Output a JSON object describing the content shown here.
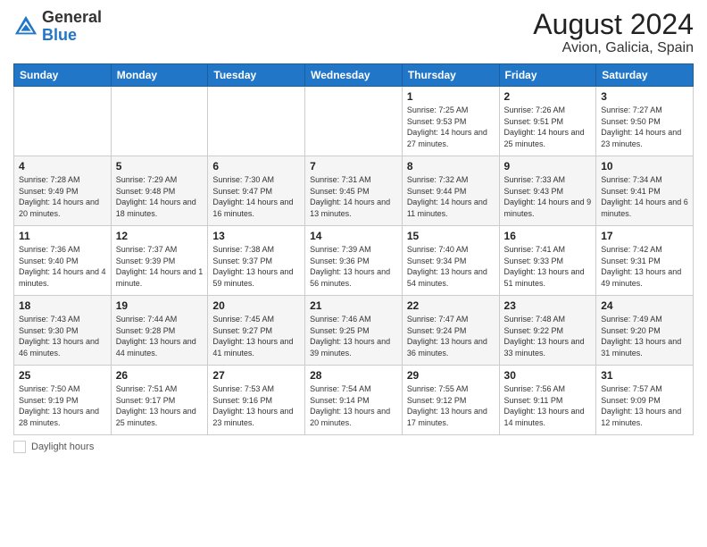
{
  "header": {
    "logo_general": "General",
    "logo_blue": "Blue",
    "month_year": "August 2024",
    "location": "Avion, Galicia, Spain"
  },
  "weekdays": [
    "Sunday",
    "Monday",
    "Tuesday",
    "Wednesday",
    "Thursday",
    "Friday",
    "Saturday"
  ],
  "footer": {
    "daylight_label": "Daylight hours"
  },
  "weeks": [
    [
      {
        "day": "",
        "info": ""
      },
      {
        "day": "",
        "info": ""
      },
      {
        "day": "",
        "info": ""
      },
      {
        "day": "",
        "info": ""
      },
      {
        "day": "1",
        "info": "Sunrise: 7:25 AM\nSunset: 9:53 PM\nDaylight: 14 hours and 27 minutes."
      },
      {
        "day": "2",
        "info": "Sunrise: 7:26 AM\nSunset: 9:51 PM\nDaylight: 14 hours and 25 minutes."
      },
      {
        "day": "3",
        "info": "Sunrise: 7:27 AM\nSunset: 9:50 PM\nDaylight: 14 hours and 23 minutes."
      }
    ],
    [
      {
        "day": "4",
        "info": "Sunrise: 7:28 AM\nSunset: 9:49 PM\nDaylight: 14 hours and 20 minutes."
      },
      {
        "day": "5",
        "info": "Sunrise: 7:29 AM\nSunset: 9:48 PM\nDaylight: 14 hours and 18 minutes."
      },
      {
        "day": "6",
        "info": "Sunrise: 7:30 AM\nSunset: 9:47 PM\nDaylight: 14 hours and 16 minutes."
      },
      {
        "day": "7",
        "info": "Sunrise: 7:31 AM\nSunset: 9:45 PM\nDaylight: 14 hours and 13 minutes."
      },
      {
        "day": "8",
        "info": "Sunrise: 7:32 AM\nSunset: 9:44 PM\nDaylight: 14 hours and 11 minutes."
      },
      {
        "day": "9",
        "info": "Sunrise: 7:33 AM\nSunset: 9:43 PM\nDaylight: 14 hours and 9 minutes."
      },
      {
        "day": "10",
        "info": "Sunrise: 7:34 AM\nSunset: 9:41 PM\nDaylight: 14 hours and 6 minutes."
      }
    ],
    [
      {
        "day": "11",
        "info": "Sunrise: 7:36 AM\nSunset: 9:40 PM\nDaylight: 14 hours and 4 minutes."
      },
      {
        "day": "12",
        "info": "Sunrise: 7:37 AM\nSunset: 9:39 PM\nDaylight: 14 hours and 1 minute."
      },
      {
        "day": "13",
        "info": "Sunrise: 7:38 AM\nSunset: 9:37 PM\nDaylight: 13 hours and 59 minutes."
      },
      {
        "day": "14",
        "info": "Sunrise: 7:39 AM\nSunset: 9:36 PM\nDaylight: 13 hours and 56 minutes."
      },
      {
        "day": "15",
        "info": "Sunrise: 7:40 AM\nSunset: 9:34 PM\nDaylight: 13 hours and 54 minutes."
      },
      {
        "day": "16",
        "info": "Sunrise: 7:41 AM\nSunset: 9:33 PM\nDaylight: 13 hours and 51 minutes."
      },
      {
        "day": "17",
        "info": "Sunrise: 7:42 AM\nSunset: 9:31 PM\nDaylight: 13 hours and 49 minutes."
      }
    ],
    [
      {
        "day": "18",
        "info": "Sunrise: 7:43 AM\nSunset: 9:30 PM\nDaylight: 13 hours and 46 minutes."
      },
      {
        "day": "19",
        "info": "Sunrise: 7:44 AM\nSunset: 9:28 PM\nDaylight: 13 hours and 44 minutes."
      },
      {
        "day": "20",
        "info": "Sunrise: 7:45 AM\nSunset: 9:27 PM\nDaylight: 13 hours and 41 minutes."
      },
      {
        "day": "21",
        "info": "Sunrise: 7:46 AM\nSunset: 9:25 PM\nDaylight: 13 hours and 39 minutes."
      },
      {
        "day": "22",
        "info": "Sunrise: 7:47 AM\nSunset: 9:24 PM\nDaylight: 13 hours and 36 minutes."
      },
      {
        "day": "23",
        "info": "Sunrise: 7:48 AM\nSunset: 9:22 PM\nDaylight: 13 hours and 33 minutes."
      },
      {
        "day": "24",
        "info": "Sunrise: 7:49 AM\nSunset: 9:20 PM\nDaylight: 13 hours and 31 minutes."
      }
    ],
    [
      {
        "day": "25",
        "info": "Sunrise: 7:50 AM\nSunset: 9:19 PM\nDaylight: 13 hours and 28 minutes."
      },
      {
        "day": "26",
        "info": "Sunrise: 7:51 AM\nSunset: 9:17 PM\nDaylight: 13 hours and 25 minutes."
      },
      {
        "day": "27",
        "info": "Sunrise: 7:53 AM\nSunset: 9:16 PM\nDaylight: 13 hours and 23 minutes."
      },
      {
        "day": "28",
        "info": "Sunrise: 7:54 AM\nSunset: 9:14 PM\nDaylight: 13 hours and 20 minutes."
      },
      {
        "day": "29",
        "info": "Sunrise: 7:55 AM\nSunset: 9:12 PM\nDaylight: 13 hours and 17 minutes."
      },
      {
        "day": "30",
        "info": "Sunrise: 7:56 AM\nSunset: 9:11 PM\nDaylight: 13 hours and 14 minutes."
      },
      {
        "day": "31",
        "info": "Sunrise: 7:57 AM\nSunset: 9:09 PM\nDaylight: 13 hours and 12 minutes."
      }
    ]
  ]
}
